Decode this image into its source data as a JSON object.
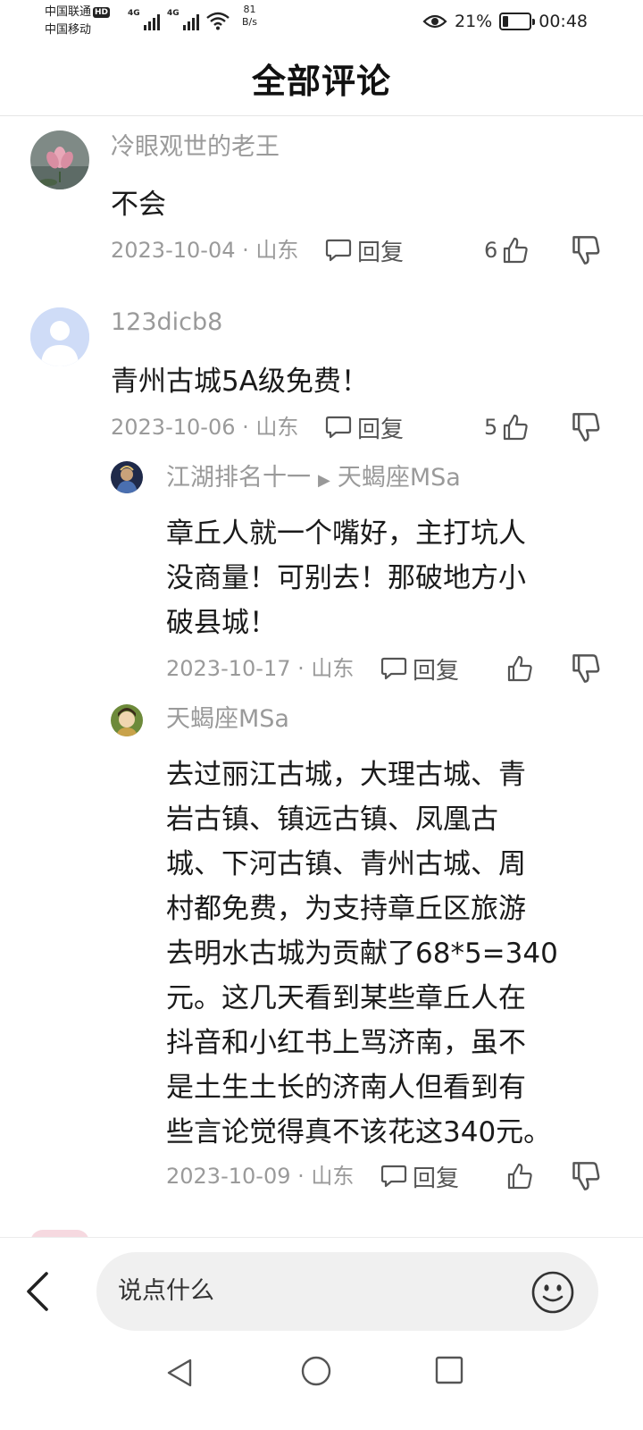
{
  "status_bar": {
    "carrier1": "中国联通",
    "hd": "HD",
    "carrier2": "中国移动",
    "net1": "4G",
    "net2": "4G",
    "speed_value": "81",
    "speed_unit": "B/s",
    "battery_percent": "21%",
    "battery_level": 0.21,
    "time": "00:48"
  },
  "header": {
    "title": "全部评论"
  },
  "comments": [
    {
      "user": "冷眼观世的老王",
      "text": "不会",
      "date": "2023-10-04 · 山东",
      "reply_label": "回复",
      "likes": "6"
    },
    {
      "user": "123dicb8",
      "text": "青州古城5A级免费！",
      "date": "2023-10-06 · 山东",
      "reply_label": "回复",
      "likes": "5"
    }
  ],
  "replies": [
    {
      "user": "江湖排名十一",
      "reply_to": "天蝎座MSa",
      "lines": [
        "章丘人就一个嘴好，主打坑人",
        "没商量！可别去！那破地方小",
        "破县城！"
      ],
      "date": "2023-10-17 · 山东",
      "reply_label": "回复",
      "likes": ""
    },
    {
      "user": "天蝎座MSa",
      "lines": [
        "去过丽江古城，大理古城、青",
        "岩古镇、镇远古镇、凤凰古",
        "城、下河古镇、青州古城、周",
        "村都免费，为支持章丘区旅游",
        "去明水古城为贡献了68*5=340",
        "元。这几天看到某些章丘人在",
        "抖音和小红书上骂济南，虽不",
        "是土生土长的济南人但看到有",
        "些言论觉得真不该花这340元。"
      ],
      "date": "2023-10-09 · 山东",
      "reply_label": "回复",
      "likes": ""
    }
  ],
  "input": {
    "placeholder": "说点什么"
  },
  "colors": {
    "secondary_text": "#9a9a9a",
    "primary_text": "#1a1a1a",
    "input_bg": "#f0f0f0"
  }
}
